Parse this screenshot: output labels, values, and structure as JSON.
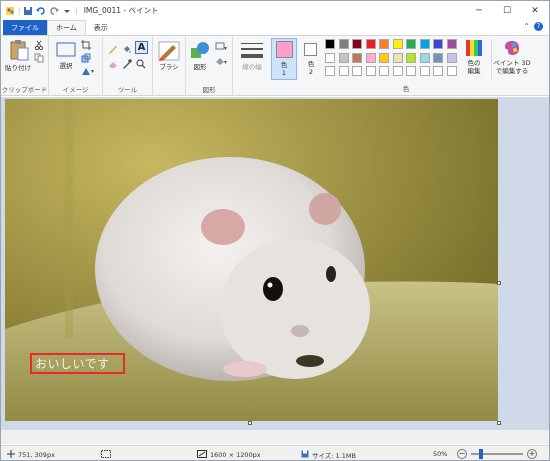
{
  "window": {
    "title": "IMG_0011 - ペイント"
  },
  "tabs": {
    "file": "ファイル",
    "home": "ホーム",
    "view": "表示"
  },
  "ribbon": {
    "clipboard": {
      "paste": "貼り付け",
      "group": "クリップボード"
    },
    "image": {
      "select": "選択",
      "group": "イメージ"
    },
    "tools": {
      "group": "ツール"
    },
    "brushes": {
      "label": "ブラシ"
    },
    "shapes": {
      "label": "図形",
      "group": "図形"
    },
    "size": {
      "label": "線の幅"
    },
    "color1": {
      "label": "色",
      "num": "1"
    },
    "color2": {
      "label": "色",
      "num": "2"
    },
    "colors_group": "色",
    "edit_colors": {
      "line1": "色の",
      "line2": "編集"
    },
    "paint3d": {
      "line1": "ペイント 3D",
      "line2": "で編集する"
    }
  },
  "palette": {
    "row1": [
      "#000000",
      "#7f7f7f",
      "#880015",
      "#ed1c24",
      "#ff7f27",
      "#fff200",
      "#22b14c",
      "#00a2e8",
      "#3f48cc",
      "#a349a4"
    ],
    "row2": [
      "#ffffff",
      "#c3c3c3",
      "#b97a57",
      "#ffaec9",
      "#ffc90e",
      "#efe4b0",
      "#b5e61d",
      "#99d9ea",
      "#7092be",
      "#c8bfe7"
    ],
    "color1": "#ff9ec8",
    "color2": "#ffffff"
  },
  "canvas": {
    "text_box": "おいしいです"
  },
  "status": {
    "cursor": "751, 309px",
    "image_size": "1600 × 1200px",
    "file_size": "サイズ: 1.1MB",
    "zoom": "50%"
  }
}
